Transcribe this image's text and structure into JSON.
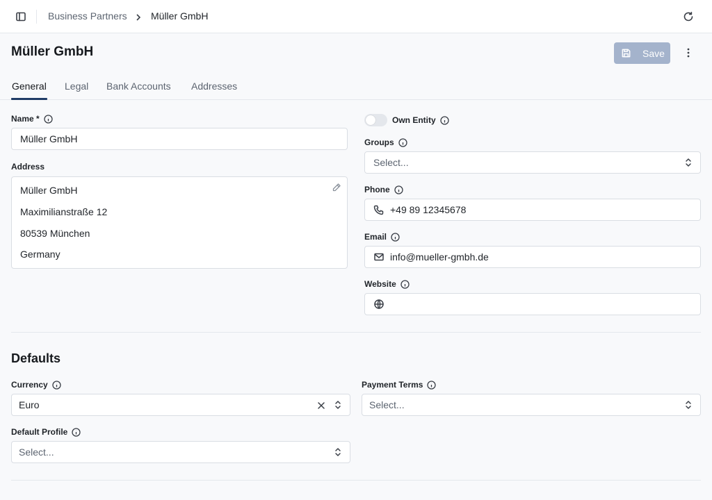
{
  "breadcrumb": {
    "parent": "Business Partners",
    "current": "Müller GmbH"
  },
  "page": {
    "title": "Müller GmbH",
    "save_label": "Save"
  },
  "tabs": [
    {
      "label": "General",
      "active": true
    },
    {
      "label": "Legal"
    },
    {
      "label": "Bank Accounts"
    },
    {
      "label": "Addresses"
    }
  ],
  "general": {
    "name": {
      "label": "Name *",
      "value": "Müller GmbH"
    },
    "address": {
      "label": "Address",
      "lines": [
        "Müller GmbH",
        "Maximilianstraße 12",
        "80539 München",
        "Germany"
      ]
    },
    "own_entity": {
      "label": "Own Entity",
      "enabled": false
    },
    "groups": {
      "label": "Groups",
      "placeholder": "Select..."
    },
    "phone": {
      "label": "Phone",
      "value": "+49 89 12345678"
    },
    "email": {
      "label": "Email",
      "value": "info@mueller-gmbh.de"
    },
    "website": {
      "label": "Website",
      "value": ""
    }
  },
  "defaults": {
    "title": "Defaults",
    "currency": {
      "label": "Currency",
      "value": "Euro"
    },
    "payment_terms": {
      "label": "Payment Terms",
      "placeholder": "Select..."
    },
    "default_profile": {
      "label": "Default Profile",
      "placeholder": "Select..."
    }
  },
  "colors": {
    "accent": "#1f3b66",
    "save_button": "#a4b3cc",
    "background": "#f8f9fb"
  }
}
